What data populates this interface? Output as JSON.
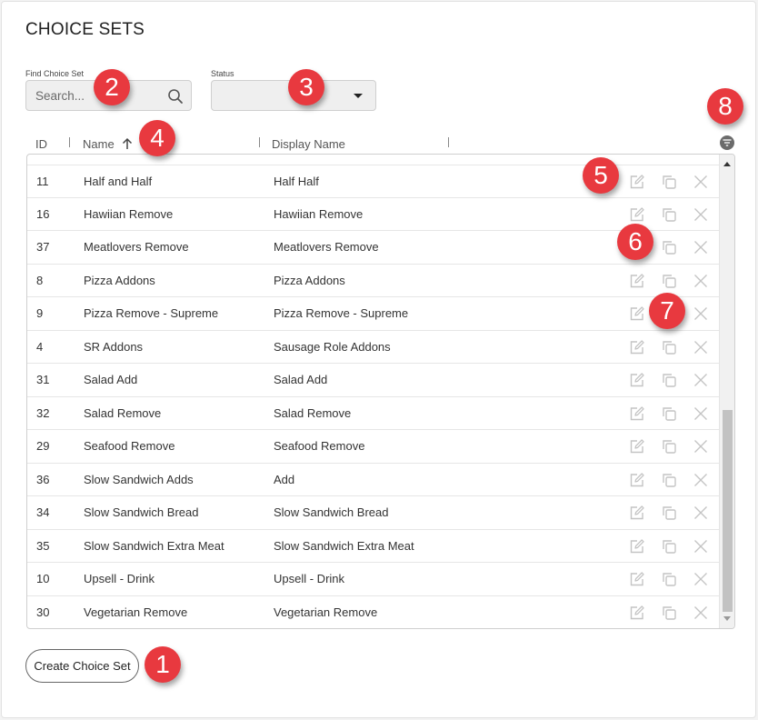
{
  "page": {
    "title": "CHOICE SETS"
  },
  "filters": {
    "search_label": "Find Choice Set",
    "search_placeholder": "Search...",
    "search_value": "",
    "status_label": "Status",
    "status_value": ""
  },
  "table": {
    "columns": [
      {
        "label": "ID"
      },
      {
        "label": "Name",
        "sort": "ascending"
      },
      {
        "label": "Display Name"
      }
    ],
    "rows": [
      {
        "id": "11",
        "name": "Half and Half",
        "display": "Half Half"
      },
      {
        "id": "16",
        "name": "Hawiian Remove",
        "display": "Hawiian Remove"
      },
      {
        "id": "37",
        "name": "Meatlovers Remove",
        "display": "Meatlovers Remove"
      },
      {
        "id": "8",
        "name": "Pizza Addons",
        "display": "Pizza Addons"
      },
      {
        "id": "9",
        "name": "Pizza Remove - Supreme",
        "display": "Pizza Remove - Supreme"
      },
      {
        "id": "4",
        "name": "SR Addons",
        "display": "Sausage Role Addons"
      },
      {
        "id": "31",
        "name": "Salad Add",
        "display": "Salad Add"
      },
      {
        "id": "32",
        "name": "Salad Remove",
        "display": "Salad Remove"
      },
      {
        "id": "29",
        "name": "Seafood Remove",
        "display": "Seafood Remove"
      },
      {
        "id": "36",
        "name": "Slow Sandwich Adds",
        "display": "Add"
      },
      {
        "id": "34",
        "name": "Slow Sandwich Bread",
        "display": "Slow Sandwich Bread"
      },
      {
        "id": "35",
        "name": "Slow Sandwich Extra Meat",
        "display": "Slow Sandwich Extra Meat"
      },
      {
        "id": "10",
        "name": "Upsell - Drink",
        "display": "Upsell - Drink"
      },
      {
        "id": "30",
        "name": "Vegetarian Remove",
        "display": "Vegetarian Remove"
      }
    ],
    "row_actions": [
      "edit-icon",
      "copy-icon",
      "delete-icon"
    ]
  },
  "buttons": {
    "create_label": "Create Choice Set"
  },
  "annotations": [
    {
      "number": "1",
      "target": "create-choice-set-button"
    },
    {
      "number": "2",
      "target": "search-input"
    },
    {
      "number": "3",
      "target": "status-select"
    },
    {
      "number": "4",
      "target": "sort-by-name"
    },
    {
      "number": "5",
      "target": "edit-action"
    },
    {
      "number": "6",
      "target": "copy-action"
    },
    {
      "number": "7",
      "target": "delete-action"
    },
    {
      "number": "8",
      "target": "column-filter"
    }
  ],
  "colors": {
    "badge": "#e8393f",
    "icon_muted": "#c4c4c4",
    "filter_icon": "#6b6b6b"
  }
}
